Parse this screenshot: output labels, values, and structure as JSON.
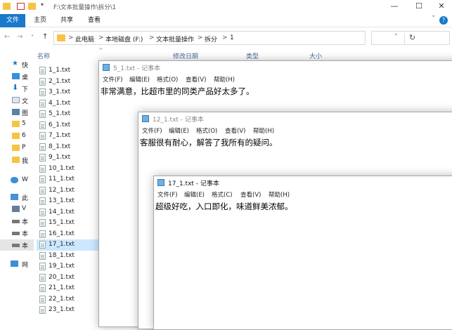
{
  "window": {
    "title": "F:\\文本批量操作\\拆分\\1",
    "controls": {
      "minimize": "—",
      "maximize": "☐",
      "close": "✕"
    }
  },
  "ribbon": {
    "tabs": [
      "文件",
      "主页",
      "共享",
      "查看"
    ],
    "help": "?",
    "expand": "˅"
  },
  "navigation": {
    "back": "←",
    "forward": "→",
    "recent": "˅",
    "up": "↑",
    "breadcrumb": [
      "此电脑",
      "本地磁盘 (F:)",
      "文本批量操作",
      "拆分",
      "1"
    ],
    "separator": ">",
    "dropdown": "˅",
    "refresh": "↻"
  },
  "nav_pane": {
    "items": [
      {
        "label": "快",
        "icon": "star-icon"
      },
      {
        "label": "桌",
        "icon": "desktop-icon"
      },
      {
        "label": "下",
        "icon": "download-icon"
      },
      {
        "label": "文",
        "icon": "document-icon"
      },
      {
        "label": "图",
        "icon": "picture-icon"
      },
      {
        "label": "5",
        "icon": "folder-icon"
      },
      {
        "label": "6",
        "icon": "folder-icon"
      },
      {
        "label": "P",
        "icon": "folder-icon"
      },
      {
        "label": "我",
        "icon": "folder-icon"
      },
      {
        "label": "W",
        "icon": "cloud-icon"
      },
      {
        "label": "此",
        "icon": "pc-icon"
      },
      {
        "label": "V",
        "icon": "video-icon"
      },
      {
        "label": "本",
        "icon": "drive-icon"
      },
      {
        "label": "本",
        "icon": "drive-icon"
      },
      {
        "label": "本",
        "icon": "drive-icon"
      },
      {
        "label": "网",
        "icon": "network-icon"
      }
    ]
  },
  "file_list": {
    "column_name": "名称",
    "sort_indicator": "^",
    "column_date": "修改日期",
    "column_type": "类型",
    "column_size": "大小",
    "files": [
      "1_1.txt",
      "2_1.txt",
      "3_1.txt",
      "4_1.txt",
      "5_1.txt",
      "6_1.txt",
      "7_1.txt",
      "8_1.txt",
      "9_1.txt",
      "10_1.txt",
      "11_1.txt",
      "12_1.txt",
      "13_1.txt",
      "14_1.txt",
      "15_1.txt",
      "16_1.txt",
      "17_1.txt",
      "18_1.txt",
      "19_1.txt",
      "20_1.txt",
      "21_1.txt",
      "22_1.txt",
      "23_1.txt"
    ],
    "selected": "17_1.txt"
  },
  "notepads": [
    {
      "title": "5_1.txt - 记事本",
      "menu": [
        "文件(F)",
        "编辑(E)",
        "格式(O)",
        "查看(V)",
        "帮助(H)"
      ],
      "content": "非常满意，比超市里的同类产品好太多了。"
    },
    {
      "title": "12_1.txt - 记事本",
      "menu": [
        "文件(F)",
        "编辑(E)",
        "格式(O)",
        "查看(V)",
        "帮助(H)"
      ],
      "content": "客服很有耐心，解答了我所有的疑问。"
    },
    {
      "title": "17_1.txt - 记事本",
      "menu": [
        "文件(F)",
        "编辑(E)",
        "格式(C)",
        "查看(V)",
        "帮助(H)"
      ],
      "content": "超级好吃，入口即化，味道鲜美浓郁。"
    }
  ],
  "colors": {
    "file_tab": "#1979ca",
    "selection": "#cce8ff",
    "folder": "#f6c343"
  }
}
